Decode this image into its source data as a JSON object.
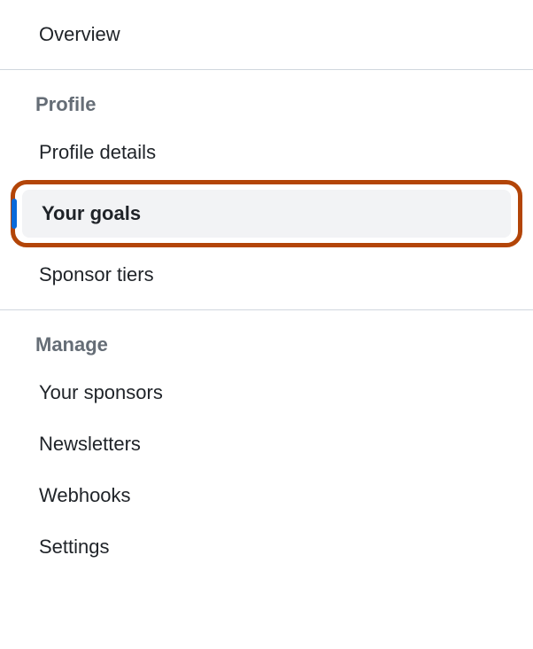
{
  "sections": [
    {
      "heading": null,
      "items": [
        {
          "label": "Overview",
          "selected": false,
          "highlighted": false
        }
      ]
    },
    {
      "heading": "Profile",
      "items": [
        {
          "label": "Profile details",
          "selected": false,
          "highlighted": false
        },
        {
          "label": "Your goals",
          "selected": true,
          "highlighted": true
        },
        {
          "label": "Sponsor tiers",
          "selected": false,
          "highlighted": false
        }
      ]
    },
    {
      "heading": "Manage",
      "items": [
        {
          "label": "Your sponsors",
          "selected": false,
          "highlighted": false
        },
        {
          "label": "Newsletters",
          "selected": false,
          "highlighted": false
        },
        {
          "label": "Webhooks",
          "selected": false,
          "highlighted": false
        },
        {
          "label": "Settings",
          "selected": false,
          "highlighted": false
        }
      ]
    }
  ]
}
